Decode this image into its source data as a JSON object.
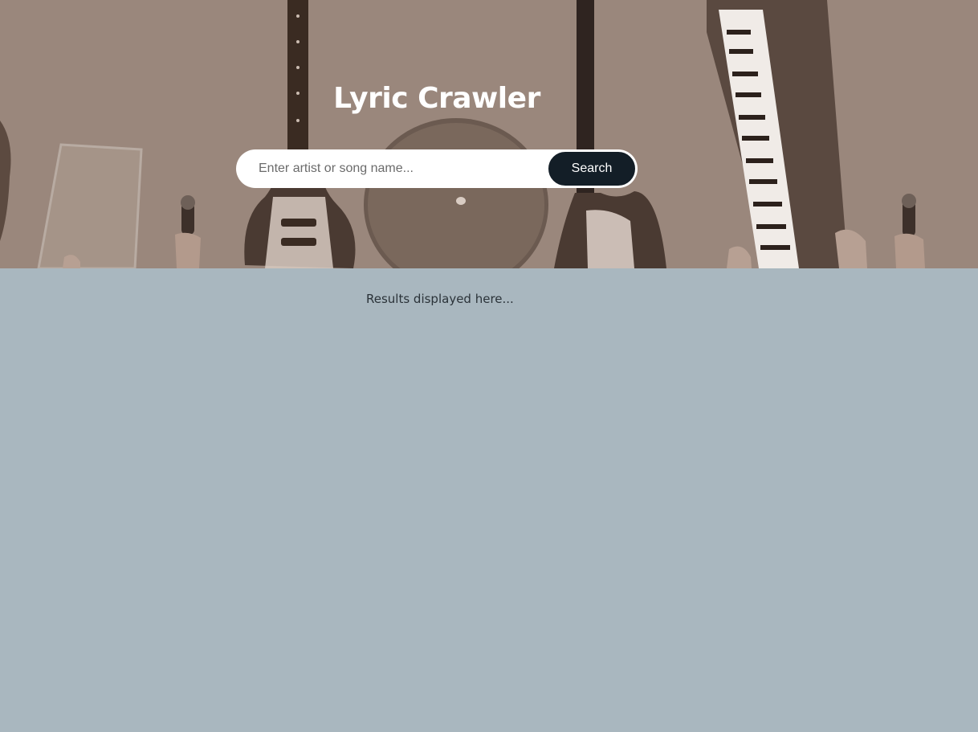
{
  "app": {
    "title": "Lyric Crawler"
  },
  "search": {
    "placeholder": "Enter artist or song name...",
    "value": "",
    "button_label": "Search"
  },
  "results": {
    "placeholder_text": "Results displayed here..."
  },
  "colors": {
    "hero_tint": "#9a877c",
    "page_background": "#a9b7bf",
    "button_background": "#131e27",
    "title_text": "#ffffff"
  }
}
